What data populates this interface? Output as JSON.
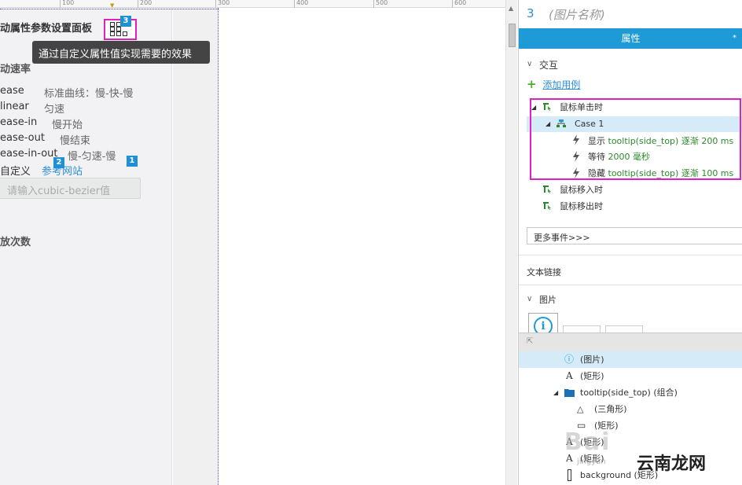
{
  "canvas": {
    "ruler_marks": [
      "100",
      "200",
      "300",
      "400",
      "500",
      "600"
    ],
    "mock_panel": {
      "title": "动属性参数设置面板",
      "speed_heading": "动速率",
      "ease_items": [
        {
          "name": "ease",
          "desc": "标准曲线：慢-快-慢"
        },
        {
          "name": "linear",
          "desc": "匀速"
        },
        {
          "name": "ease-in",
          "desc": "慢开始"
        },
        {
          "name": "ease-out",
          "desc": "慢结束"
        },
        {
          "name": "ease-in-out",
          "desc": "慢-匀速-慢"
        }
      ],
      "custom_label": "自定义",
      "reference_link": "参考网站",
      "bezier_placeholder": "请输入cubic-bezier值",
      "count_heading": "放次数"
    },
    "badges": {
      "one": "1",
      "two": "2",
      "three": "3"
    },
    "tooltip_text": "通过自定义属性值实现需要的效果"
  },
  "inspector": {
    "widget_number": "3",
    "widget_name": "(图片名称)",
    "tab_label": "属性",
    "tab_star": "*",
    "interaction_heading": "交互",
    "add_case": "添加用例",
    "events": {
      "click": "鼠标单击时",
      "case_name": "Case 1",
      "actions": [
        {
          "verb": "显示",
          "target": "tooltip(side_top) 逐渐 200 ms"
        },
        {
          "verb": "等待",
          "target": "2000 毫秒"
        },
        {
          "verb": "隐藏",
          "target": "tooltip(side_top) 逐渐 100 ms"
        }
      ],
      "mouse_enter": "鼠标移入时",
      "mouse_leave": "鼠标移出时"
    },
    "more_events": "更多事件>>>",
    "text_link": "文本链接",
    "image_heading": "图片",
    "accent_color": "#1e9bd7"
  },
  "outline": {
    "rows": [
      {
        "label": "(图片)",
        "icon": "info-icon"
      },
      {
        "label": "(矩形)",
        "icon": "text-a-icon"
      },
      {
        "label": "tooltip(side_top) (组合)",
        "icon": "folder-icon"
      },
      {
        "label": "(三角形)",
        "icon": "triangle-icon"
      },
      {
        "label": "(矩形)",
        "icon": "rect-icon"
      },
      {
        "label": "(矩形)",
        "icon": "text-a-icon"
      },
      {
        "label": "(矩形)",
        "icon": "text-a-icon"
      },
      {
        "label": "background (矩形)",
        "icon": "vertical-rect-icon"
      }
    ]
  },
  "watermark": {
    "baidu": "Bai",
    "site": "云南龙网",
    "sub": "jingyan"
  }
}
